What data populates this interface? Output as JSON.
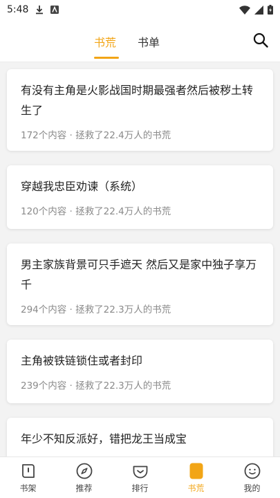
{
  "status_bar": {
    "time": "5:48"
  },
  "header": {
    "tabs": [
      {
        "label": "书荒",
        "active": true
      },
      {
        "label": "书单",
        "active": false
      }
    ]
  },
  "cards": [
    {
      "title": "有没有主角是火影战国时期最强者然后被秽土转生了",
      "meta": "172个内容 · 拯救了22.4万人的书荒"
    },
    {
      "title": "穿越我忠臣劝谏（系统）",
      "meta": "120个内容 · 拯救了22.4万人的书荒"
    },
    {
      "title": "男主家族背景可只手遮天 然后又是家中独子享万千",
      "meta": "294个内容 · 拯救了22.3万人的书荒"
    },
    {
      "title": "主角被铁链锁住或者封印",
      "meta": "239个内容 · 拯救了22.3万人的书荒"
    },
    {
      "title": "年少不知反派好，错把龙王当成宝",
      "meta": ""
    }
  ],
  "bottom_nav": [
    {
      "label": "书架",
      "icon": "bookshelf-icon",
      "active": false
    },
    {
      "label": "推荐",
      "icon": "compass-icon",
      "active": false
    },
    {
      "label": "排行",
      "icon": "ranking-icon",
      "active": false
    },
    {
      "label": "书荒",
      "icon": "book-shortage-icon",
      "active": true
    },
    {
      "label": "我的",
      "icon": "profile-icon",
      "active": false
    }
  ],
  "colors": {
    "accent": "#f2a516",
    "background": "#f3f3f3",
    "meta_text": "#8a8a8a"
  }
}
